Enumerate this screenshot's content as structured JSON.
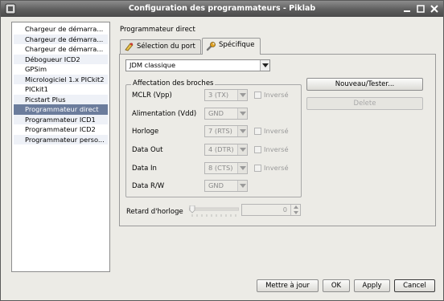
{
  "window": {
    "title": "Configuration des programmateurs - Piklab"
  },
  "nav": {
    "items": [
      {
        "label": "Chargeur de démarra...",
        "selected": false
      },
      {
        "label": "Chargeur de démarra...",
        "selected": false
      },
      {
        "label": "Chargeur de démarra...",
        "selected": false
      },
      {
        "label": "Débogueur ICD2",
        "selected": false
      },
      {
        "label": "GPSim",
        "selected": false
      },
      {
        "label": "Micrologiciel 1.x PICkit2",
        "selected": false
      },
      {
        "label": "PICkit1",
        "selected": false
      },
      {
        "label": "Picstart Plus",
        "selected": false
      },
      {
        "label": "Programmateur direct",
        "selected": true
      },
      {
        "label": "Programmateur ICD1",
        "selected": false
      },
      {
        "label": "Programmateur ICD2",
        "selected": false
      },
      {
        "label": "Programmateur perso...",
        "selected": false
      }
    ]
  },
  "main": {
    "section_title": "Programmateur direct",
    "tabs": [
      {
        "label": "Sélection du port",
        "icon": "port-selection-icon",
        "active": false
      },
      {
        "label": "Spécifique",
        "icon": "wrench-icon",
        "active": true
      }
    ],
    "programmer_type": "JDM classique",
    "pins_group_title": "Affectation des broches",
    "pins": [
      {
        "label": "MCLR (Vpp)",
        "value": "3 (TX)",
        "has_invert": true
      },
      {
        "label": "Alimentation (Vdd)",
        "value": "GND",
        "has_invert": false
      },
      {
        "label": "Horloge",
        "value": "7 (RTS)",
        "has_invert": true
      },
      {
        "label": "Data Out",
        "value": "4 (DTR)",
        "has_invert": true
      },
      {
        "label": "Data In",
        "value": "8 (CTS)",
        "has_invert": true
      },
      {
        "label": "Data R/W",
        "value": "GND",
        "has_invert": false
      }
    ],
    "invert_label": "Inversé",
    "new_test_button": "Nouveau/Tester...",
    "delete_button": "Delete",
    "clock_delay_label": "Retard d'horloge",
    "clock_delay_value": "0"
  },
  "buttons": {
    "update": "Mettre à jour",
    "ok": "OK",
    "apply": "Apply",
    "cancel": "Cancel"
  },
  "colors": {
    "title_bar": "#5e5e5e",
    "selection": "#6b7c9c",
    "window_bg": "#ecebe6"
  }
}
